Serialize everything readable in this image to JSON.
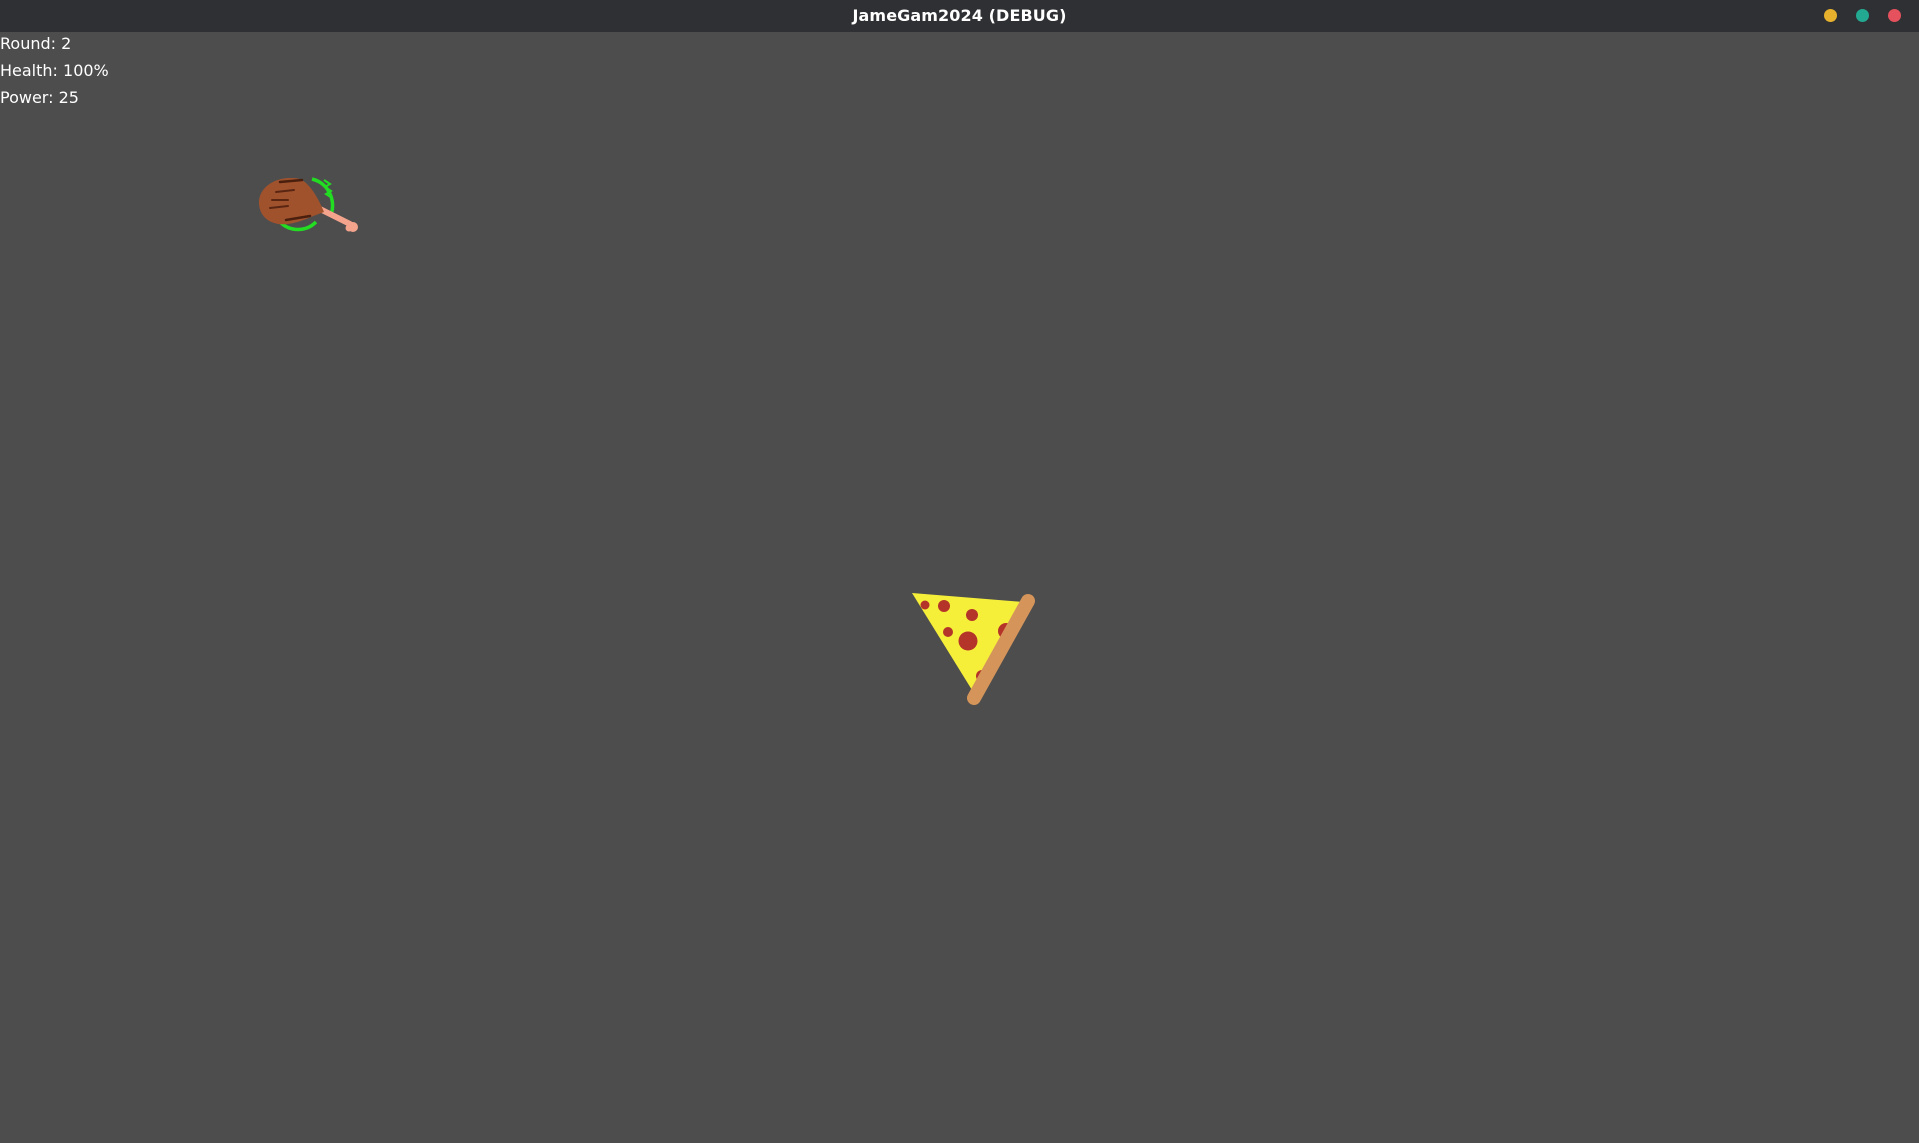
{
  "window": {
    "title": "JameGam2024 (DEBUG)",
    "buttons": {
      "minimize_color": "#e7b12d",
      "maximize_color": "#23a891",
      "close_color": "#e5515d"
    }
  },
  "hud": {
    "round": "Round: 2",
    "health": "Health: 100%",
    "power": "Power: 25"
  },
  "scene": {
    "background_color": "#4d4d4d",
    "player_sprite": "chicken-drumstick-icon",
    "player_ring_color": "#22dd22",
    "enemy_sprite": "pizza-slice-icon"
  }
}
